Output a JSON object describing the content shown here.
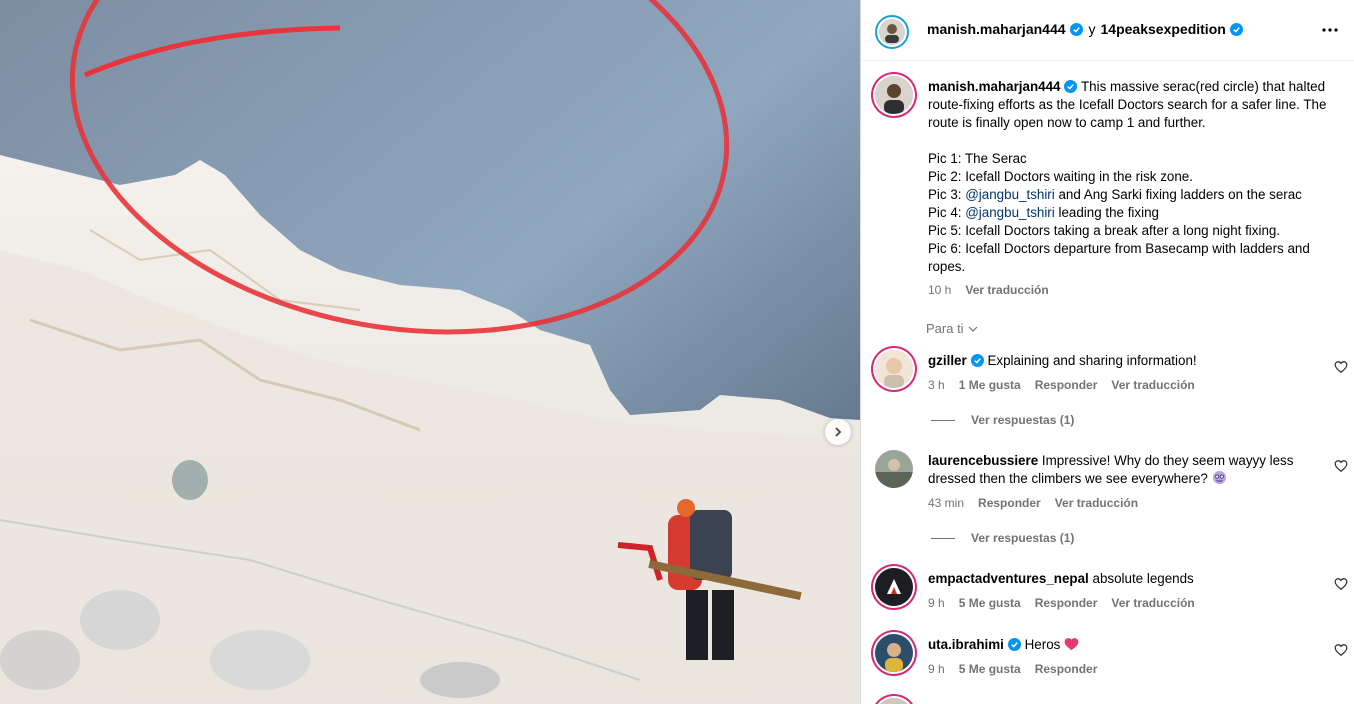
{
  "header": {
    "author": "manish.maharjan444",
    "connector": "y",
    "coauthor": "14peaksexpedition"
  },
  "caption": {
    "user": "manish.maharjan444",
    "intro": "This massive serac(red circle) that halted route-fixing efforts as the Icefall Doctors search for a safer line. The route is finally open now to camp 1 and further.",
    "pic1": "Pic 1: The Serac",
    "pic2": "Pic 2: Icefall Doctors waiting in the risk zone.",
    "pic3_prefix": "Pic 3: ",
    "pic3_mention": "@jangbu_tshiri",
    "pic3_suffix": " and Ang Sarki fixing ladders on the serac",
    "pic4_prefix": "Pic 4: ",
    "pic4_mention": "@jangbu_tshiri",
    "pic4_suffix": " leading the fixing",
    "pic5": "Pic 5: Icefall Doctors taking a break after a long night fixing.",
    "pic6": "Pic 6: Icefall Doctors departure from Basecamp with ladders and ropes.",
    "time": "10 h",
    "translate": "Ver traducción"
  },
  "para_ti": "Para ti",
  "comments": [
    {
      "user": "gziller",
      "text": "Explaining and sharing information!",
      "time": "3 h",
      "likes": "1 Me gusta",
      "reply": "Responder",
      "translate": "Ver traducción",
      "replies": "Ver respuestas (1)"
    },
    {
      "user": "laurencebussiere",
      "text": "Impressive! Why do they seem wayyy less dressed then the climbers we see everywhere?",
      "time": "43 min",
      "reply": "Responder",
      "translate": "Ver traducción",
      "replies": "Ver respuestas (1)"
    },
    {
      "user": "empactadventures_nepal",
      "text": "absolute legends",
      "time": "9 h",
      "likes": "5 Me gusta",
      "reply": "Responder",
      "translate": "Ver traducción"
    },
    {
      "user": "uta.ibrahimi",
      "text": "Heros",
      "time": "9 h",
      "likes": "5 Me gusta",
      "reply": "Responder"
    }
  ],
  "colors": {
    "verified": "#0095f6",
    "mention": "#00376b",
    "meta": "#737373",
    "story_ring": "#d62976",
    "annotation_circle": "#e8343a"
  },
  "icons": [
    "verified-badge-icon",
    "more-options-icon",
    "heart-icon",
    "chevron-down-icon",
    "next-arrow-icon"
  ]
}
